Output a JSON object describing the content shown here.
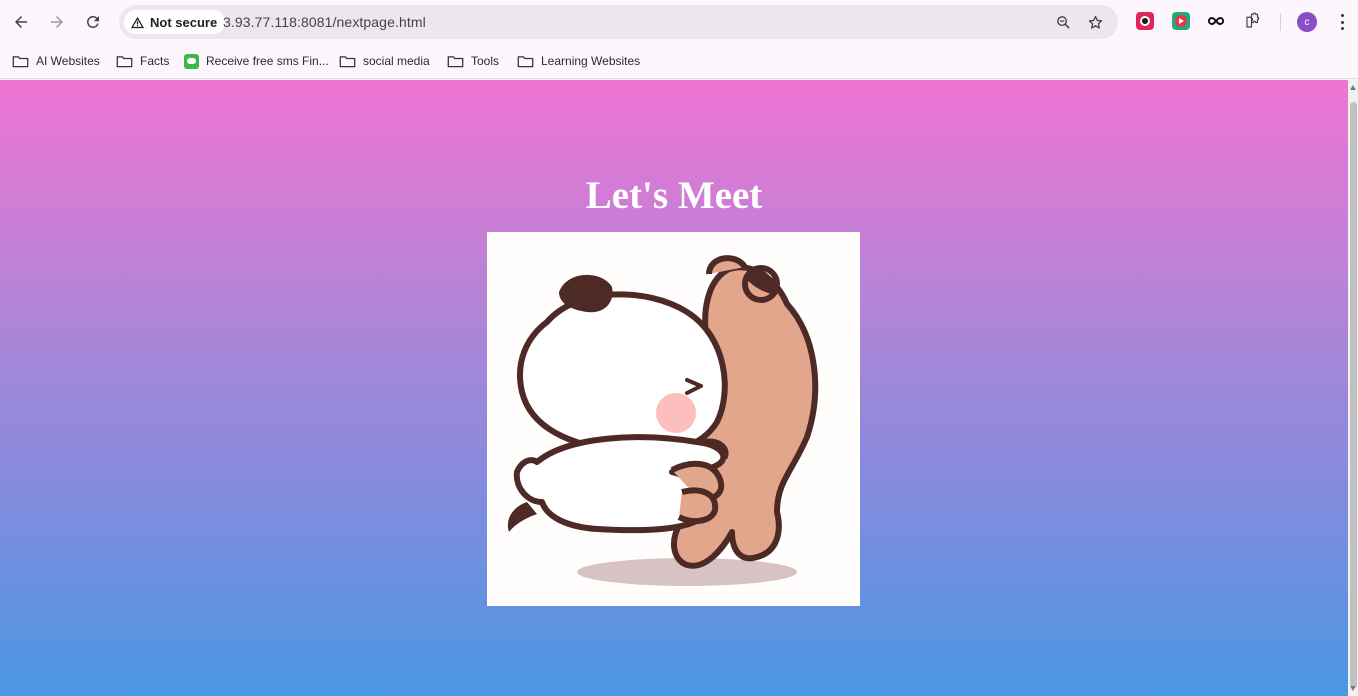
{
  "browser": {
    "security_label": "Not secure",
    "url": "3.93.77.118:8081/nextpage.html",
    "profile_initial": "c",
    "extensions": [
      "music-extension-icon",
      "video-extension-icon",
      "infinity-extension-icon",
      "puzzle-icon"
    ]
  },
  "bookmarks": [
    {
      "label": "AI Websites",
      "icon": "folder-icon"
    },
    {
      "label": "Facts",
      "icon": "folder-icon"
    },
    {
      "label": "Receive free sms Fin...",
      "icon": "sms-favicon"
    },
    {
      "label": "social media",
      "icon": "folder-icon"
    },
    {
      "label": "Tools",
      "icon": "folder-icon"
    },
    {
      "label": "Learning Websites",
      "icon": "folder-icon"
    }
  ],
  "page": {
    "heading": "Let's Meet",
    "image_subject": "cartoon panda hugging brown bear gif",
    "colors": {
      "gradient_top": "#ef74d4",
      "gradient_bottom": "#4a97e3"
    }
  }
}
